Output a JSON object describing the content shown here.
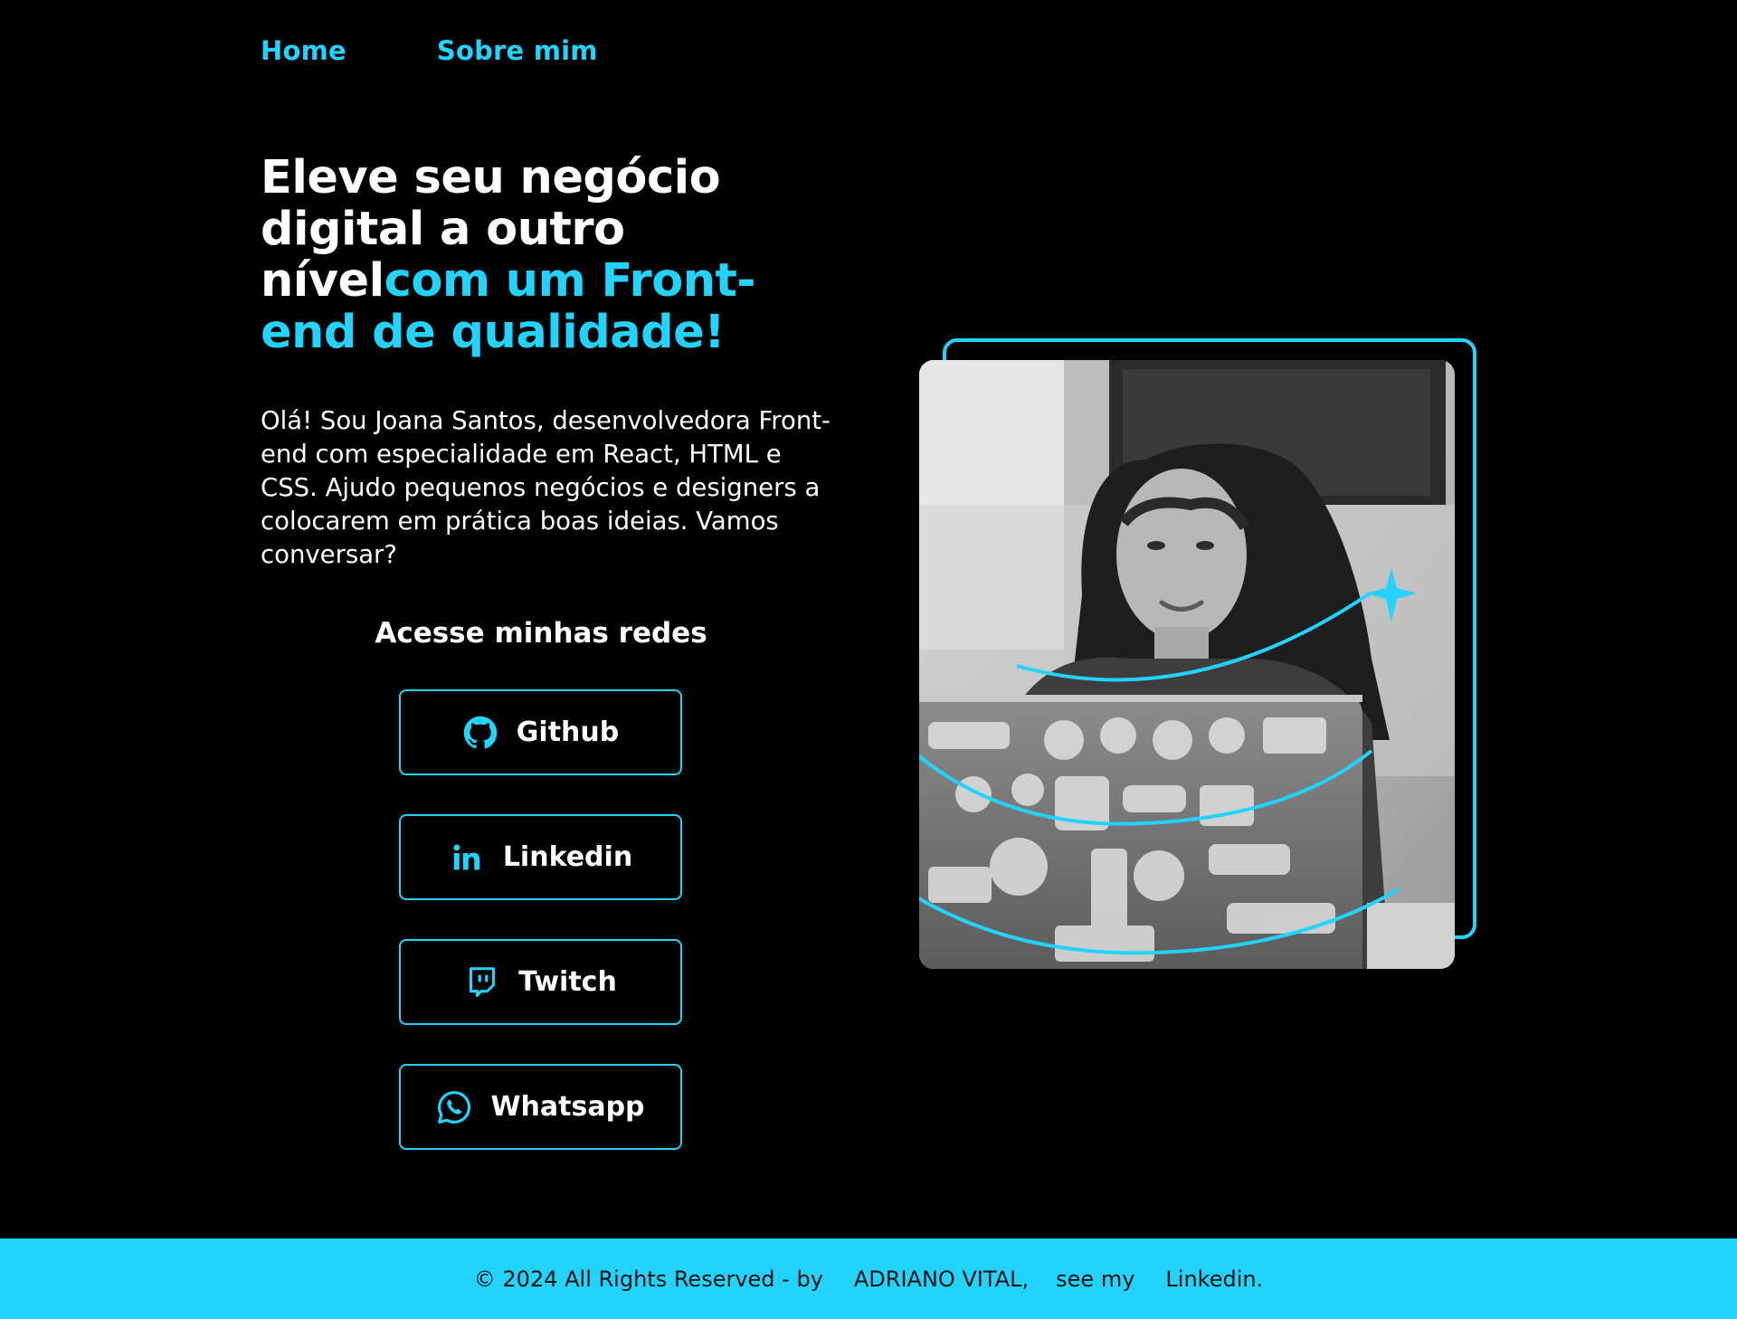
{
  "nav": {
    "home": "Home",
    "about": "Sobre mim"
  },
  "hero": {
    "title_white": "Eleve seu negócio digital a outro nível",
    "title_accent": "com um Front-end de qualidade!",
    "intro": "Olá! Sou Joana Santos, desenvolvedora Front-end com especialidade em React, HTML e CSS. Ajudo pequenos negócios e designers a colocarem em prática boas ideias. Vamos conversar?"
  },
  "social": {
    "title": "Acesse minhas redes",
    "items": [
      {
        "label": "Github",
        "icon": "github-icon"
      },
      {
        "label": "Linkedin",
        "icon": "linkedin-icon"
      },
      {
        "label": "Twitch",
        "icon": "twitch-icon"
      },
      {
        "label": "Whatsapp",
        "icon": "whatsapp-icon"
      }
    ]
  },
  "photo": {
    "icon": "profile-photo"
  },
  "footer": {
    "copyright": "© 2024 All Rights Reserved - by",
    "author": "ADRIANO VITAL,",
    "see_my": "see my",
    "linkedin": "Linkedin."
  },
  "colors": {
    "accent": "#22d4fd",
    "background": "#000000",
    "text": "#ffffff"
  }
}
